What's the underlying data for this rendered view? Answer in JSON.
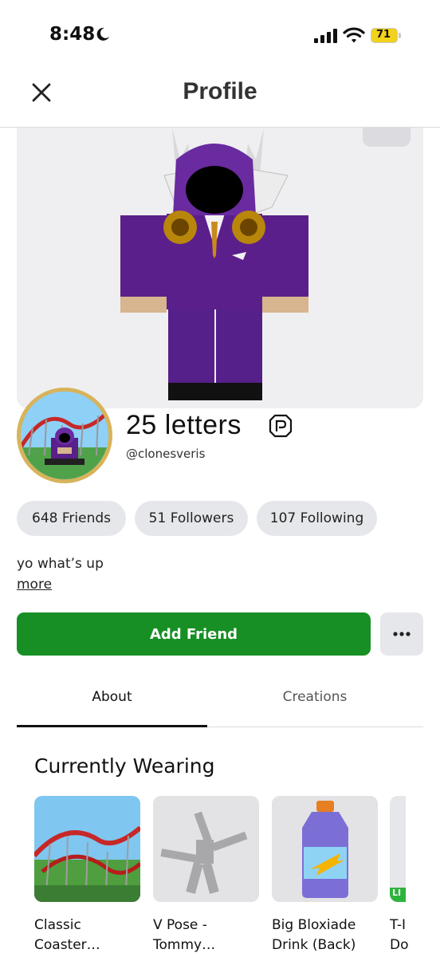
{
  "status_bar": {
    "time": "8:48",
    "battery_level": "71",
    "icons": [
      "moon-icon",
      "signal-icon",
      "wifi-icon",
      "battery-icon"
    ]
  },
  "header": {
    "title": "Profile",
    "close_icon": "close-icon"
  },
  "profile": {
    "display_name": "25 letters",
    "username": "@clonesveris",
    "premium_icon": "premium-icon",
    "bio": "yo what’s up",
    "more_label": "more"
  },
  "stats": [
    {
      "label": "648 Friends"
    },
    {
      "label": "51 Followers"
    },
    {
      "label": "107 Following"
    }
  ],
  "actions": {
    "add_friend_label": "Add Friend",
    "more_options_icon": "ellipsis-icon"
  },
  "tabs": [
    {
      "label": "About",
      "selected": true
    },
    {
      "label": "Creations",
      "selected": false
    }
  ],
  "currently_wearing": {
    "title": "Currently Wearing",
    "items": [
      {
        "line1": "Classic",
        "line2": "Coaster…"
      },
      {
        "line1": "V Pose -",
        "line2": "Tommy…"
      },
      {
        "line1": "Big Bloxiade",
        "line2": "Drink (Back)"
      },
      {
        "line1": "T-I",
        "line2": "Do",
        "badge": "LI"
      }
    ]
  },
  "colors": {
    "accent_green": "#178f24",
    "pill_bg": "#e6e7ea",
    "avatar_purple": "#5a1f8a",
    "battery_yellow": "#f2d21a"
  }
}
